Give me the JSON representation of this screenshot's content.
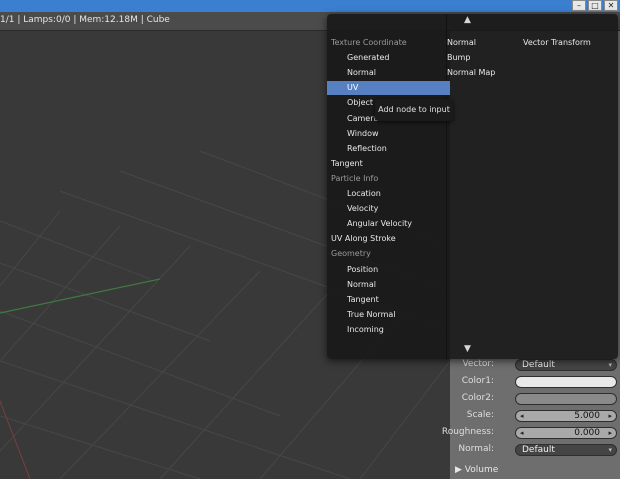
{
  "window": {
    "minimize_glyph": "–",
    "maximize_glyph": "□",
    "close_glyph": "✕"
  },
  "header": {
    "info": "1/1 | Lamps:0/0 | Mem:12.18M | Cube"
  },
  "menu": {
    "scroll_up_glyph": "▲",
    "scroll_down_glyph": "▼",
    "col1": [
      {
        "label": "Texture Coordinate",
        "type": "header"
      },
      {
        "label": "Generated",
        "type": "item"
      },
      {
        "label": "Normal",
        "type": "item"
      },
      {
        "label": "UV",
        "type": "selected"
      },
      {
        "label": "Object",
        "type": "item"
      },
      {
        "label": "Camera",
        "type": "item"
      },
      {
        "label": "Window",
        "type": "item"
      },
      {
        "label": "Reflection",
        "type": "item"
      },
      {
        "label": "Tangent",
        "type": "top"
      },
      {
        "label": "Particle Info",
        "type": "header"
      },
      {
        "label": "Location",
        "type": "item"
      },
      {
        "label": "Velocity",
        "type": "item"
      },
      {
        "label": "Angular Velocity",
        "type": "item"
      },
      {
        "label": "UV Along Stroke",
        "type": "top"
      },
      {
        "label": "Geometry",
        "type": "header"
      },
      {
        "label": "Position",
        "type": "item"
      },
      {
        "label": "Normal",
        "type": "item"
      },
      {
        "label": "Tangent",
        "type": "item"
      },
      {
        "label": "True Normal",
        "type": "item"
      },
      {
        "label": "Incoming",
        "type": "item"
      }
    ],
    "col2": [
      "Normal",
      "Bump",
      "Normal Map"
    ],
    "col3": [
      "Vector Transform"
    ],
    "tooltip": "Add node to input"
  },
  "properties": {
    "vector_label": "Vector:",
    "vector_value": "Default",
    "color1_label": "Color1:",
    "color2_label": "Color2:",
    "scale_label": "Scale:",
    "scale_value": "5.000",
    "roughness_label": "Roughness:",
    "roughness_value": "0.000",
    "normal_label": "Normal:",
    "normal_value": "Default",
    "volume_label": "Volume",
    "expand_glyph": "▶"
  }
}
